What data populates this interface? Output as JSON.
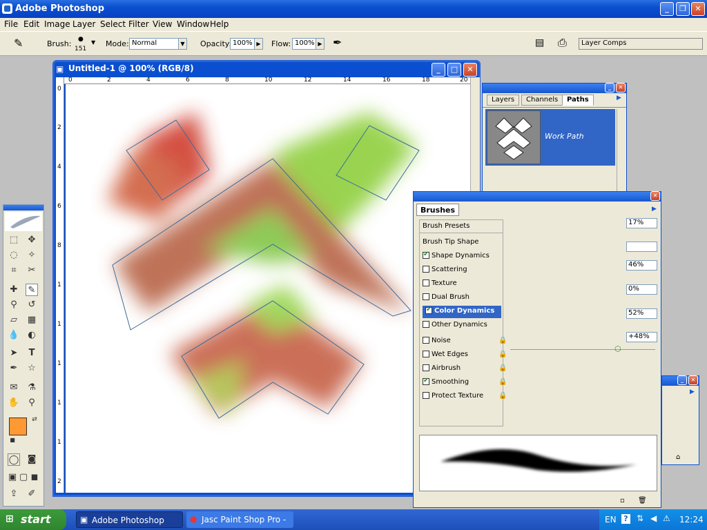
{
  "app": {
    "title": "Adobe Photoshop"
  },
  "menu": [
    "File",
    "Edit",
    "Image",
    "Layer",
    "Select",
    "Filter",
    "View",
    "Window",
    "Help"
  ],
  "options": {
    "brush_label": "Brush:",
    "brush_size": "151",
    "mode_label": "Mode:",
    "mode_value": "Normal",
    "opacity_label": "Opacity:",
    "opacity_value": "100%",
    "flow_label": "Flow:",
    "flow_value": "100%",
    "layer_comps": "Layer Comps"
  },
  "document": {
    "title": "Untitled-1 @ 100% (RGB/8)",
    "ruler_top": [
      "0",
      "2",
      "4",
      "6",
      "8",
      "10",
      "12",
      "14",
      "16",
      "18",
      "20"
    ],
    "ruler_left": [
      "0",
      "2",
      "4",
      "6",
      "8",
      "1",
      "1",
      "1",
      "1",
      "1",
      "2"
    ]
  },
  "layers_panel": {
    "tabs": [
      "Layers",
      "Channels",
      "Paths"
    ],
    "active_tab": "Paths",
    "path_name": "Work Path"
  },
  "brushes_panel": {
    "tab": "Brushes",
    "items": [
      {
        "label": "Brush Presets",
        "type": "header"
      },
      {
        "label": "Brush Tip Shape",
        "type": "header"
      },
      {
        "label": "Shape Dynamics",
        "checked": true
      },
      {
        "label": "Scattering",
        "checked": false
      },
      {
        "label": "Texture",
        "checked": false
      },
      {
        "label": "Dual Brush",
        "checked": false
      },
      {
        "label": "Color Dynamics",
        "checked": true,
        "selected": true
      },
      {
        "label": "Other Dynamics",
        "checked": false
      },
      {
        "label": "Noise",
        "checked": false
      },
      {
        "label": "Wet Edges",
        "checked": false
      },
      {
        "label": "Airbrush",
        "checked": false
      },
      {
        "label": "Smoothing",
        "checked": true
      },
      {
        "label": "Protect Texture",
        "checked": false
      }
    ],
    "values": [
      "17%",
      "46%",
      "0%",
      "52%",
      "+48%"
    ]
  },
  "taskbar": {
    "start": "start",
    "items": [
      "Adobe Photoshop",
      "Jasc Paint Shop Pro - ..."
    ],
    "language": "EN",
    "time": "12:24"
  },
  "colors": {
    "foreground": "#ff9933",
    "background": "#ffffff"
  }
}
